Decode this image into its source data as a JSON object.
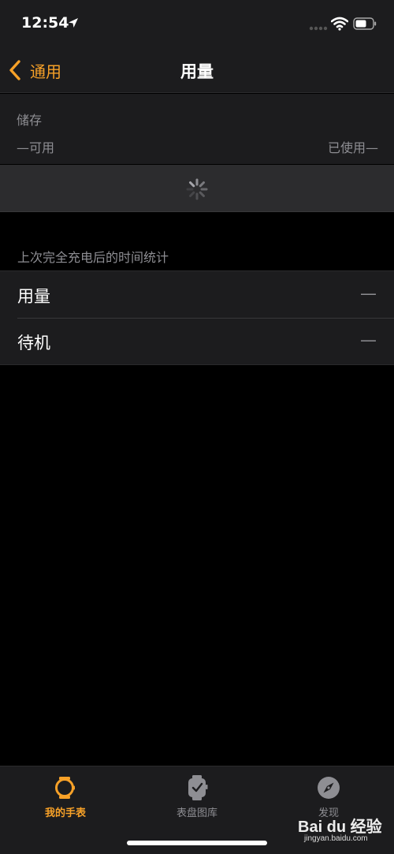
{
  "status_bar": {
    "time": "12:54",
    "icons": [
      "location-arrow-icon",
      "signal-dots-icon",
      "wifi-icon",
      "battery-icon"
    ]
  },
  "nav": {
    "back_label": "通用",
    "title": "用量"
  },
  "storage": {
    "title": "储存",
    "available": "—可用",
    "used": "已使用—"
  },
  "battery_section": {
    "header": "上次完全充电后的时间统计",
    "rows": [
      {
        "label": "用量",
        "value": "—"
      },
      {
        "label": "待机",
        "value": "—"
      }
    ]
  },
  "tabs": [
    {
      "label": "我的手表",
      "icon": "watch-icon",
      "active": true
    },
    {
      "label": "表盘图库",
      "icon": "watch-face-icon",
      "active": false
    },
    {
      "label": "发现",
      "icon": "compass-icon",
      "active": false
    }
  ],
  "watermark": {
    "logo_text": "Bai du 经验",
    "url": "jingyan.baidu.com"
  },
  "colors": {
    "accent": "#f7a128",
    "background": "#000000",
    "surface": "#1c1c1e",
    "secondary_text": "#8e8e93"
  }
}
